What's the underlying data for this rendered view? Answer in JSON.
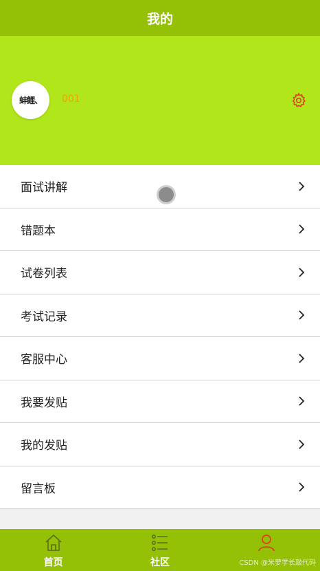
{
  "header": {
    "title": "我的"
  },
  "profile": {
    "avatar_text": "蚌鲤、",
    "username": "001"
  },
  "menu": [
    {
      "label": "面试讲解"
    },
    {
      "label": "错题本"
    },
    {
      "label": "试卷列表"
    },
    {
      "label": "考试记录"
    },
    {
      "label": "客服中心"
    },
    {
      "label": "我要发贴"
    },
    {
      "label": "我的发贴"
    },
    {
      "label": "留言板"
    }
  ],
  "tabbar": {
    "tabs": [
      {
        "label": "首页",
        "icon": "home-icon"
      },
      {
        "label": "社区",
        "icon": "list-icon"
      },
      {
        "label": "",
        "icon": "user-icon",
        "active": true
      }
    ]
  },
  "watermark": "CSDN @米萝学长敲代码",
  "colors": {
    "header_bg": "#94c006",
    "profile_bg": "#b0e61a",
    "username": "#f0a30a",
    "active_icon": "#e0401a"
  }
}
